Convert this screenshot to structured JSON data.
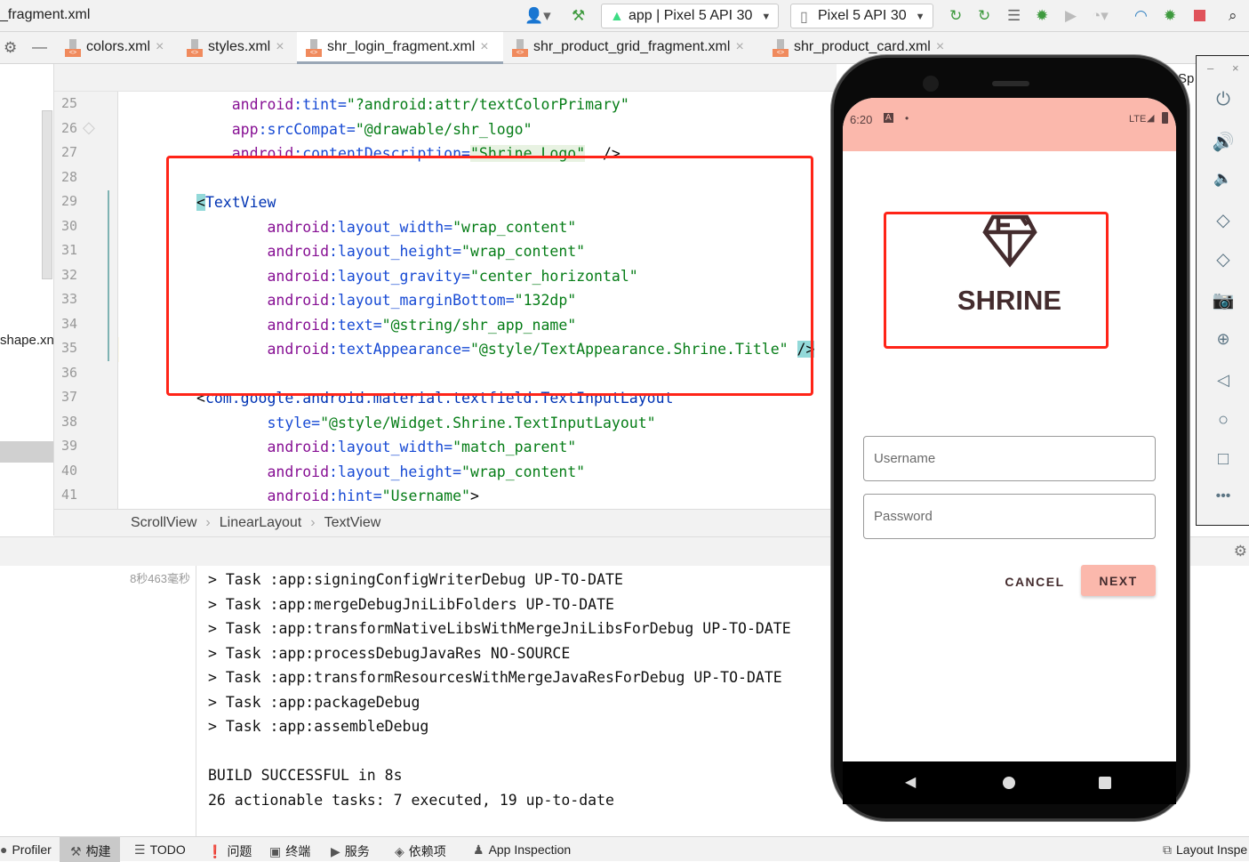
{
  "window_title": "_fragment.xml",
  "toolbar": {
    "run_config": "app | Pixel 5 API 30",
    "device": "Pixel 5 API 30",
    "icons": [
      "user-icon",
      "hammer-icon",
      "apply-changes-icon",
      "apply-code-changes-icon",
      "sync-icon",
      "debug-icon",
      "attach-icon",
      "profile-icon",
      "profiler-gauge-icon",
      "attach-debugger-icon",
      "stop-icon",
      "search-icon"
    ]
  },
  "tabs": [
    {
      "label": "colors.xml"
    },
    {
      "label": "styles.xml"
    },
    {
      "label": "shr_login_fragment.xml",
      "active": true
    },
    {
      "label": "shr_product_grid_fragment.xml"
    },
    {
      "label": "shr_product_card.xml"
    }
  ],
  "project_panel": {
    "partial_item": "shape.xn",
    "right_overflow": "Sp"
  },
  "editor": {
    "line_numbers": [
      "25",
      "26",
      "27",
      "28",
      "29",
      "30",
      "31",
      "32",
      "33",
      "34",
      "35",
      "36",
      "37",
      "38",
      "39",
      "40",
      "41"
    ],
    "lines": [
      [
        [
          "pl",
          "    "
        ],
        [
          "ns",
          "android"
        ],
        [
          "at",
          ":tint="
        ],
        [
          "va",
          "\"?android:attr/textColorPrimary\""
        ]
      ],
      [
        [
          "pl",
          "    "
        ],
        [
          "ns",
          "app"
        ],
        [
          "at",
          ":srcCompat="
        ],
        [
          "va",
          "\"@drawable/shr_logo\""
        ]
      ],
      [
        [
          "pl",
          "    "
        ],
        [
          "ns",
          "android"
        ],
        [
          "at",
          ":contentDescription="
        ],
        [
          "va sel",
          "\"Shrine Logo\""
        ],
        [
          "pl",
          "  />"
        ]
      ],
      [],
      [
        [
          "pl hl",
          "<"
        ],
        [
          "tg",
          "TextView"
        ]
      ],
      [
        [
          "pl",
          "        "
        ],
        [
          "ns",
          "android"
        ],
        [
          "at",
          ":layout_width="
        ],
        [
          "va",
          "\"wrap_content\""
        ]
      ],
      [
        [
          "pl",
          "        "
        ],
        [
          "ns",
          "android"
        ],
        [
          "at",
          ":layout_height="
        ],
        [
          "va",
          "\"wrap_content\""
        ]
      ],
      [
        [
          "pl",
          "        "
        ],
        [
          "ns",
          "android"
        ],
        [
          "at",
          ":layout_gravity="
        ],
        [
          "va",
          "\"center_horizontal\""
        ]
      ],
      [
        [
          "pl",
          "        "
        ],
        [
          "ns",
          "android"
        ],
        [
          "at",
          ":layout_marginBottom="
        ],
        [
          "va",
          "\"132dp\""
        ]
      ],
      [
        [
          "pl",
          "        "
        ],
        [
          "ns",
          "android"
        ],
        [
          "at",
          ":text="
        ],
        [
          "va",
          "\"@string/shr_app_name\""
        ]
      ],
      [
        [
          "pl",
          "        "
        ],
        [
          "ns",
          "android"
        ],
        [
          "at",
          ":textAppearance="
        ],
        [
          "va",
          "\"@style/TextAppearance.Shrine.Title\""
        ],
        [
          "pl",
          " "
        ],
        [
          "pl hl",
          "/>"
        ]
      ],
      [],
      [
        [
          "pl",
          "<"
        ],
        [
          "tg",
          "com.google.android.material.textfield.TextInputLayout"
        ]
      ],
      [
        [
          "pl",
          "        "
        ],
        [
          "at",
          "style="
        ],
        [
          "va",
          "\"@style/Widget.Shrine.TextInputLayout\""
        ]
      ],
      [
        [
          "pl",
          "        "
        ],
        [
          "ns",
          "android"
        ],
        [
          "at",
          ":layout_width="
        ],
        [
          "va",
          "\"match_parent\""
        ]
      ],
      [
        [
          "pl",
          "        "
        ],
        [
          "ns",
          "android"
        ],
        [
          "at",
          ":layout_height="
        ],
        [
          "va",
          "\"wrap_content\""
        ]
      ],
      [
        [
          "pl",
          "        "
        ],
        [
          "ns",
          "android"
        ],
        [
          "at",
          ":hint="
        ],
        [
          "va",
          "\"Username\""
        ],
        [
          "pl",
          ">"
        ]
      ]
    ]
  },
  "breadcrumb": [
    "ScrollView",
    "LinearLayout",
    "TextView"
  ],
  "build": {
    "time": "8秒463毫秒",
    "lines": [
      "> Task :app:signingConfigWriterDebug UP-TO-DATE",
      "> Task :app:mergeDebugJniLibFolders UP-TO-DATE",
      "> Task :app:transformNativeLibsWithMergeJniLibsForDebug UP-TO-DATE",
      "> Task :app:processDebugJavaRes NO-SOURCE",
      "> Task :app:transformResourcesWithMergeJavaResForDebug UP-TO-DATE",
      "> Task :app:packageDebug",
      "> Task :app:assembleDebug",
      "",
      "BUILD SUCCESSFUL in 8s",
      "26 actionable tasks: 7 executed, 19 up-to-date"
    ]
  },
  "bottom_bar": [
    {
      "label": "Profiler",
      "icon": "profiler-icon"
    },
    {
      "label": "构建",
      "icon": "hammer-icon",
      "active": true
    },
    {
      "label": "TODO",
      "icon": "list-icon"
    },
    {
      "label": "问题",
      "icon": "problems-icon"
    },
    {
      "label": "终端",
      "icon": "terminal-icon"
    },
    {
      "label": "服务",
      "icon": "services-icon"
    },
    {
      "label": "依赖项",
      "icon": "dependencies-icon"
    },
    {
      "label": "App Inspection",
      "icon": "app-inspection-icon"
    },
    {
      "label": "Layout Inspe",
      "icon": "layout-inspector-icon"
    }
  ],
  "phone": {
    "status_time": "6:20",
    "network": "LTE",
    "app_title": "SHRINE",
    "username_hint": "Username",
    "password_hint": "Password",
    "cancel_label": "CANCEL",
    "next_label": "NEXT",
    "colors": {
      "primary": "#fbb8ac",
      "on_primary": "#442c2e"
    }
  },
  "emulator_panel": [
    "power-icon",
    "volume-up-icon",
    "volume-down-icon",
    "rotate-left-icon",
    "rotate-right-icon",
    "camera-icon",
    "zoom-icon",
    "back-icon",
    "home-icon",
    "overview-icon",
    "more-icon"
  ]
}
